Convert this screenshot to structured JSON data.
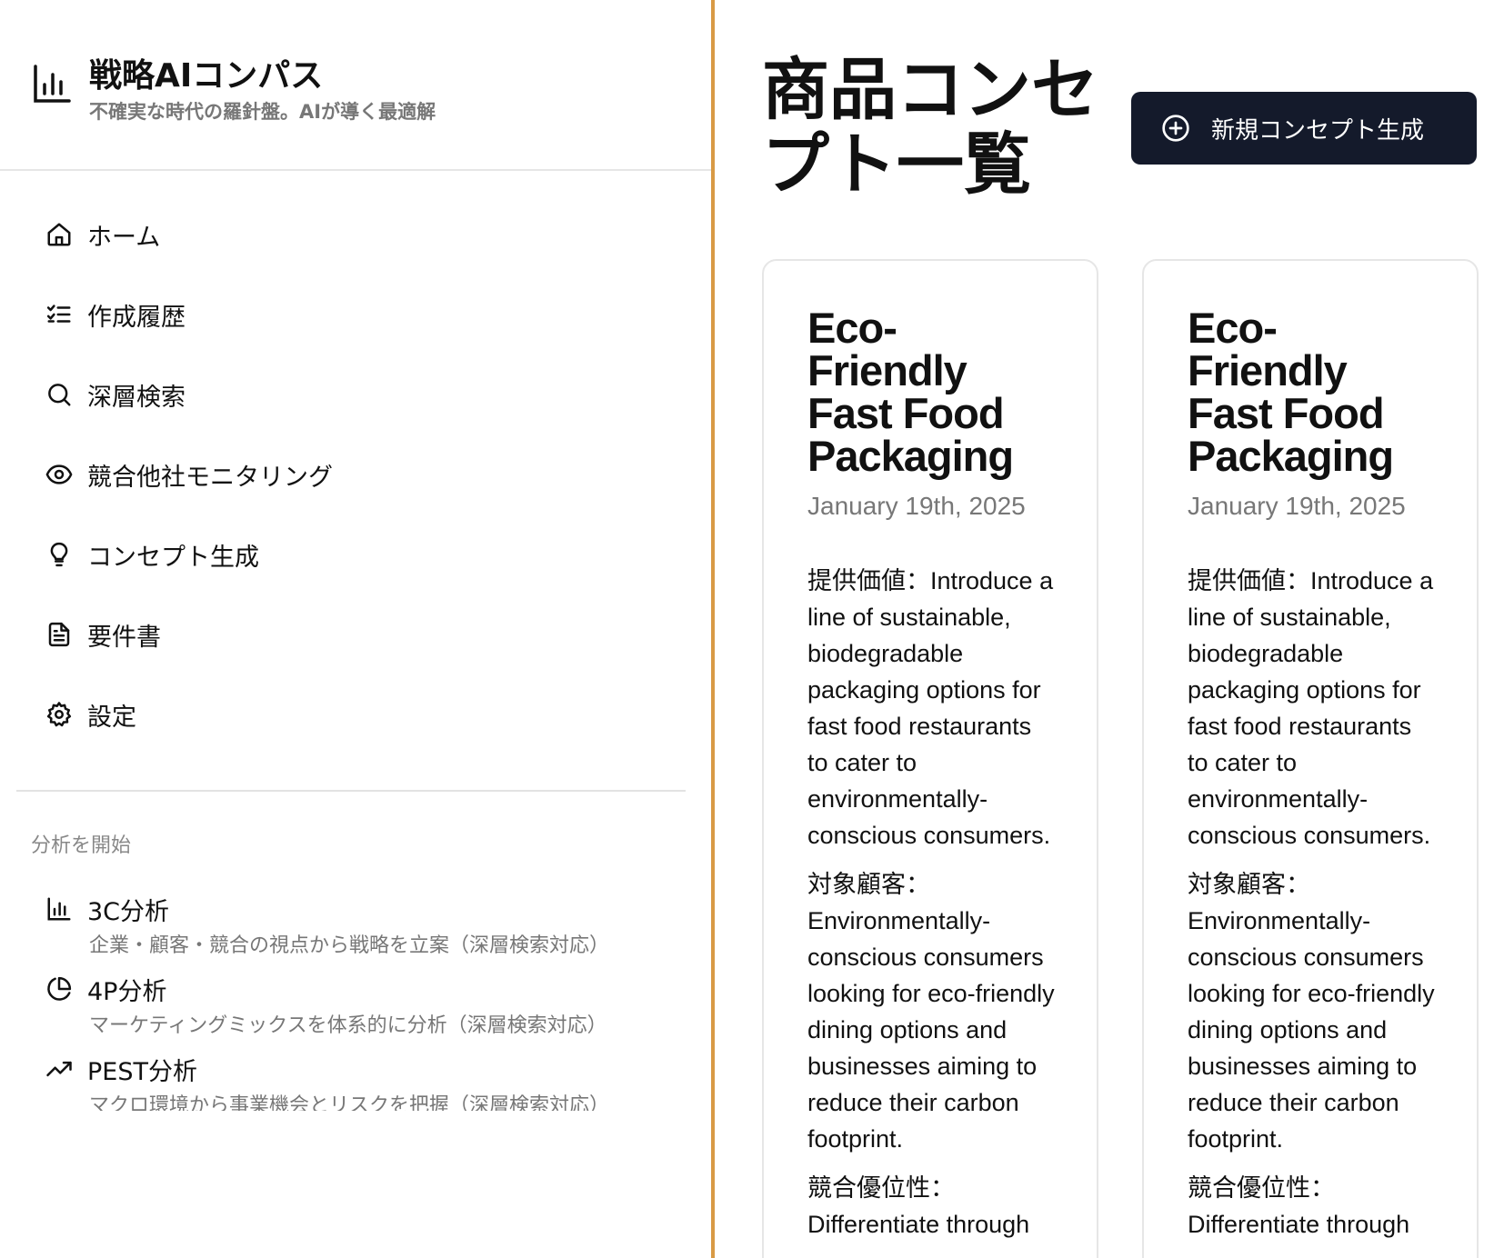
{
  "brand": {
    "title": "戦略AIコンパス",
    "subtitle": "不確実な時代の羅針盤。AIが導く最適解",
    "icon": "bar-chart-icon"
  },
  "nav": {
    "items": [
      {
        "label": "ホーム",
        "icon": "home-icon"
      },
      {
        "label": "作成履歴",
        "icon": "list-checks-icon"
      },
      {
        "label": "深層検索",
        "icon": "search-icon"
      },
      {
        "label": "競合他社モニタリング",
        "icon": "eye-icon"
      },
      {
        "label": "コンセプト生成",
        "icon": "lightbulb-icon"
      },
      {
        "label": "要件書",
        "icon": "document-icon"
      },
      {
        "label": "設定",
        "icon": "gear-icon"
      }
    ]
  },
  "analysis": {
    "section_title": "分析を開始",
    "items": [
      {
        "name": "3C分析",
        "desc": "企業・顧客・競合の視点から戦略を立案（深層検索対応）",
        "icon": "bar-chart-icon"
      },
      {
        "name": "4P分析",
        "desc": "マーケティングミックスを体系的に分析（深層検索対応）",
        "icon": "pie-chart-icon"
      },
      {
        "name": "PEST分析",
        "desc": "マクロ環境から事業機会とリスクを把握（深層検索対応）",
        "icon": "trending-up-icon"
      }
    ]
  },
  "main": {
    "title": "商品コンセプト一覧",
    "new_button_label": "新規コンセプト生成",
    "new_button_icon": "plus-circle-icon",
    "cards": [
      {
        "title": "Eco-Friendly Fast Food Packaging",
        "date": "January 19th, 2025",
        "value": "提供価値：Introduce a line of sustainable, biodegradable packaging options for fast food restaurants to cater to environmentally-conscious consumers.",
        "target": "対象顧客：Environmentally-conscious consumers looking for eco-friendly dining options and businesses aiming to reduce their carbon footprint.",
        "advantage": "競合優位性：Differentiate through"
      },
      {
        "title": "Eco-Friendly Fast Food Packaging",
        "date": "January 19th, 2025",
        "value": "提供価値：Introduce a line of sustainable, biodegradable packaging options for fast food restaurants to cater to environmentally-conscious consumers.",
        "target": "対象顧客：Environmentally-conscious consumers looking for eco-friendly dining options and businesses aiming to reduce their carbon footprint.",
        "advantage": "競合優位性：Differentiate through"
      }
    ]
  },
  "colors": {
    "accent_border": "#d89a45",
    "button_bg": "#141a2b",
    "muted_text": "#777777"
  }
}
